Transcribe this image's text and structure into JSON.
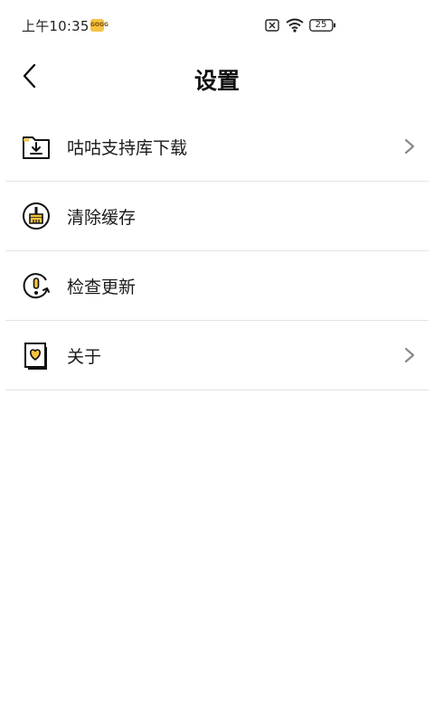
{
  "status_bar": {
    "time": "上午10:35",
    "app_badge_text": "GOGG",
    "battery_level": "25",
    "icons": [
      "sim-off-icon",
      "wifi-icon",
      "battery-icon"
    ]
  },
  "header": {
    "title": "设置",
    "back_icon": "back-arrow-icon"
  },
  "settings": {
    "items": [
      {
        "label": "咕咕支持库下载",
        "icon": "download-folder-icon",
        "has_chevron": true
      },
      {
        "label": "清除缓存",
        "icon": "broom-icon",
        "has_chevron": false
      },
      {
        "label": "检查更新",
        "icon": "update-alert-icon",
        "has_chevron": false
      },
      {
        "label": "关于",
        "icon": "heart-book-icon",
        "has_chevron": true
      }
    ]
  },
  "colors": {
    "accent_yellow": "#f5c242",
    "divider": "#e2e2e2",
    "chevron": "#8a8a8a"
  }
}
